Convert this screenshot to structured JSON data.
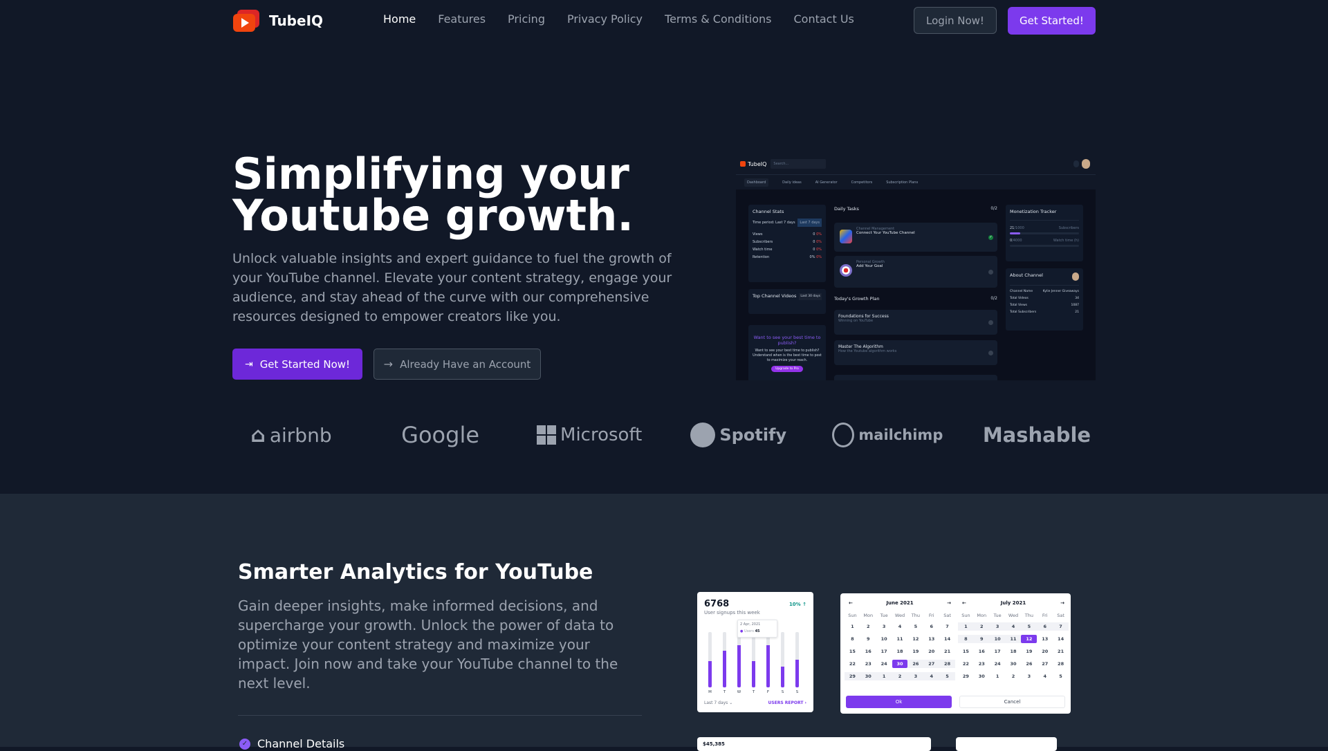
{
  "nav": {
    "brand": "TubeIQ",
    "links": [
      "Home",
      "Features",
      "Pricing",
      "Privacy Policy",
      "Terms & Conditions",
      "Contact Us"
    ],
    "active": "Home",
    "login_label": "Login Now!",
    "start_label": "Get Started!"
  },
  "hero": {
    "title_line1": "Simplifying your",
    "title_line2": "Youtube growth.",
    "subtitle": "Unlock valuable insights and expert guidance to fuel the growth of your YouTube channel. Elevate your content strategy, engage your audience, and stay ahead of the curve with our comprehensive resources designed to empower creators like you.",
    "primary_btn": "Get Started Now!",
    "secondary_btn": "Already Have an Account"
  },
  "dashboard": {
    "brand": "TubeIQ",
    "search_placeholder": "Search...",
    "tabs": [
      "Dashboard",
      "Daily ideas",
      "AI Generator",
      "Competitors",
      "Subscription Plans"
    ],
    "channel_stats": {
      "title": "Channel Stats",
      "period_label": "Time period: Last 7 days",
      "period_select": "Last 7 days",
      "rows": [
        {
          "label": "Views",
          "value": "0",
          "change": "0%"
        },
        {
          "label": "Subscribers",
          "value": "0",
          "change": "0%"
        },
        {
          "label": "Watch time",
          "value": "0",
          "change": "0%"
        },
        {
          "label": "Retention",
          "value": "0%",
          "change": "0%"
        }
      ]
    },
    "top_videos": {
      "title": "Top Channel Videos",
      "period": "Last 30 days"
    },
    "promo": {
      "title": "Want to see your best time to publish?",
      "text": "Want to see your best time to publish? Understand when is the best time to post to maximize your reach.",
      "button": "Upgrade to Pro"
    },
    "daily_tasks": {
      "title": "Daily Tasks",
      "count": "0/2",
      "items": [
        {
          "category": "Channel Management",
          "title": "Connect Your YouTube Channel",
          "done": true
        },
        {
          "category": "Personal Growth",
          "title": "Add Your Goal",
          "done": false
        }
      ]
    },
    "growth_plan": {
      "title": "Today's Growth Plan",
      "count": "0/2",
      "items": [
        {
          "title": "Foundations for Success",
          "subtitle": "Winning on YouTube"
        },
        {
          "title": "Master The Algorithm",
          "subtitle": "How the Youtube algorithm works"
        }
      ]
    },
    "monetization": {
      "title": "Monetization Tracker",
      "subs_value": "21",
      "subs_target": "/1000",
      "subs_label": "Subscribers",
      "subs_progress": 0.021,
      "watch_value": "0",
      "watch_target": "/4000",
      "watch_label": "Watch time (h)",
      "watch_progress": 0
    },
    "about": {
      "title": "About Channel",
      "rows": [
        {
          "label": "Channel Name",
          "value": "Kylie Jenner Giveaways"
        },
        {
          "label": "Total Videos",
          "value": "34"
        },
        {
          "label": "Total Views",
          "value": "1087"
        },
        {
          "label": "Total Subscribers",
          "value": "21"
        }
      ]
    }
  },
  "logos": [
    "airbnb",
    "Google",
    "Microsoft",
    "Spotify",
    "mailchimp",
    "Mashable"
  ],
  "analytics": {
    "title": "Smarter Analytics for YouTube",
    "subtitle": "Gain deeper insights, make informed decisions, and supercharge your growth. Unlock the power of data to optimize your content strategy and maximize your impact. Join now and take your YouTube channel to the next level.",
    "features": [
      "Channel Details"
    ]
  },
  "signups_card": {
    "value": "6768",
    "label": "User signups this week",
    "change": "10% ↑",
    "tooltip_date": "2 Apr, 2021",
    "tooltip_label": "Users",
    "tooltip_value": "45",
    "days": [
      "M",
      "T",
      "W",
      "T",
      "F",
      "S",
      "S"
    ],
    "values": [
      0.47,
      0.66,
      0.76,
      0.47,
      0.76,
      0.38,
      0.5
    ],
    "footer_left": "Last 7 days",
    "footer_right": "USERS REPORT"
  },
  "calendar": {
    "left_month": "June 2021",
    "right_month": "July 2021",
    "dow": [
      "Sun",
      "Mon",
      "Tue",
      "Wed",
      "Thu",
      "Fri",
      "Sat"
    ],
    "left_days": [
      "1",
      "2",
      "3",
      "4",
      "5",
      "6",
      "7",
      "8",
      "9",
      "10",
      "11",
      "12",
      "13",
      "14",
      "15",
      "16",
      "17",
      "18",
      "19",
      "20",
      "21",
      "22",
      "23",
      "24",
      "30",
      "26",
      "27",
      "28",
      "29",
      "30",
      "1",
      "2",
      "3",
      "4",
      "5"
    ],
    "right_days": [
      "1",
      "2",
      "3",
      "4",
      "5",
      "6",
      "7",
      "8",
      "9",
      "10",
      "11",
      "12",
      "13",
      "14",
      "15",
      "16",
      "17",
      "18",
      "19",
      "20",
      "21",
      "22",
      "23",
      "24",
      "30",
      "26",
      "27",
      "28",
      "29",
      "30",
      "1",
      "2",
      "3",
      "4",
      "5"
    ],
    "left_selected_index": 24,
    "right_selected_index": 11,
    "ok_label": "Ok",
    "cancel_label": "Cancel"
  },
  "revenue_card": {
    "value": "$45,385"
  }
}
